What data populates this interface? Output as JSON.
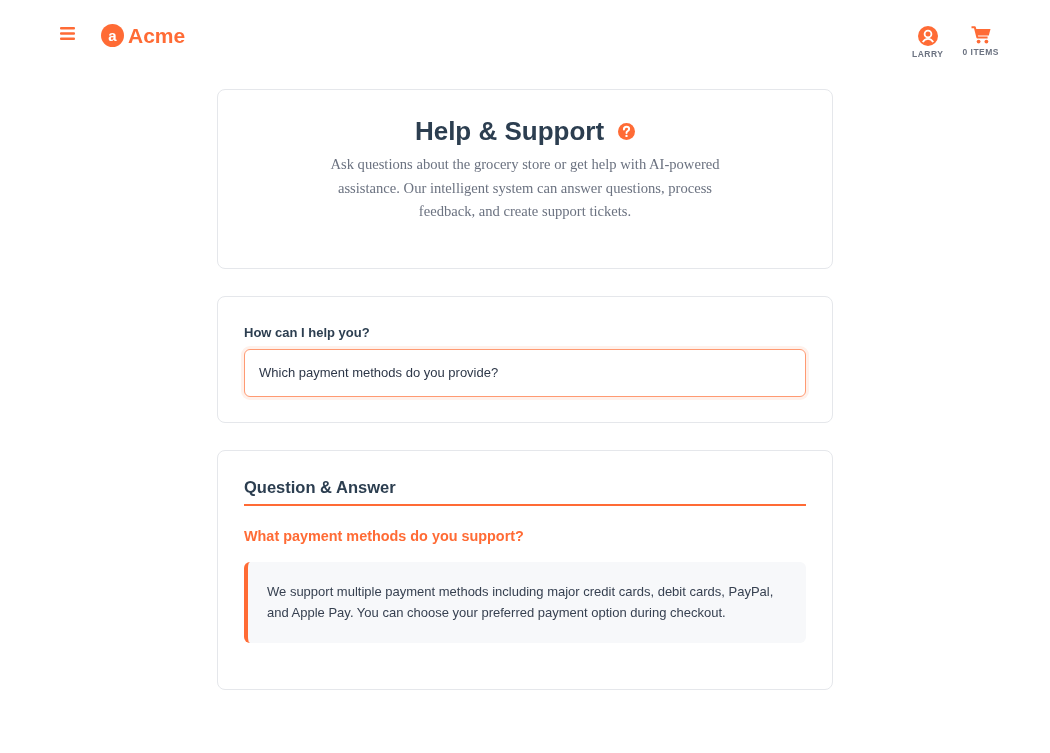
{
  "header": {
    "logo_letter": "a",
    "brand_name": "Acme",
    "account_label": "LARRY",
    "cart_label": "0 ITEMS"
  },
  "intro": {
    "title": "Help & Support",
    "description": "Ask questions about the grocery store or get help with AI-powered assistance. Our intelligent system can answer questions, process feedback, and create support tickets."
  },
  "query": {
    "label": "How can I help you?",
    "value": "Which payment methods do you provide?",
    "focused": true
  },
  "qa": {
    "heading": "Question & Answer",
    "items": [
      {
        "question": "What payment methods do you support?",
        "answer": "We support multiple payment methods including major credit cards, debit cards, PayPal, and Apple Pay. You can choose your preferred payment option during checkout."
      }
    ]
  }
}
